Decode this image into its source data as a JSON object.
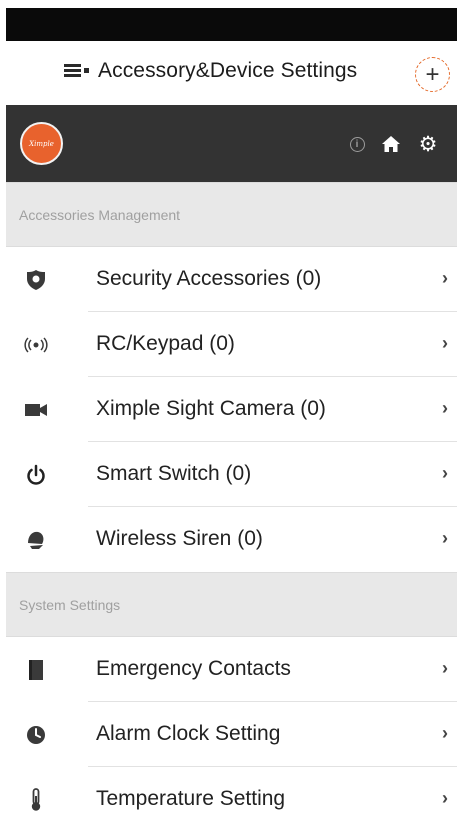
{
  "header": {
    "title": "Accessory&Device Settings",
    "add_label": "+",
    "menu_icon": "menu-list-icon",
    "info_icon": "info-icon",
    "home_icon": "home-icon",
    "settings_icon": "gear-icon"
  },
  "logo": {
    "text": "Ximple"
  },
  "colors": {
    "accent": "#e8622d",
    "dark_bar": "#333333",
    "section_bg": "#e8e8e8"
  },
  "sections": [
    {
      "title": "Accessories Management",
      "items": [
        {
          "label": "Security Accessories (0)",
          "icon": "shield-icon"
        },
        {
          "label": "RC/Keypad (0)",
          "icon": "signal-icon"
        },
        {
          "label": "Ximple Sight Camera (0)",
          "icon": "camera-icon"
        },
        {
          "label": "Smart Switch (0)",
          "icon": "power-icon"
        },
        {
          "label": "Wireless Siren (0)",
          "icon": "siren-icon"
        }
      ]
    },
    {
      "title": "System Settings",
      "items": [
        {
          "label": "Emergency Contacts",
          "icon": "contacts-book-icon"
        },
        {
          "label": "Alarm Clock Setting",
          "icon": "clock-icon"
        },
        {
          "label": "Temperature Setting",
          "icon": "thermometer-icon"
        }
      ]
    }
  ],
  "chevron": "›"
}
